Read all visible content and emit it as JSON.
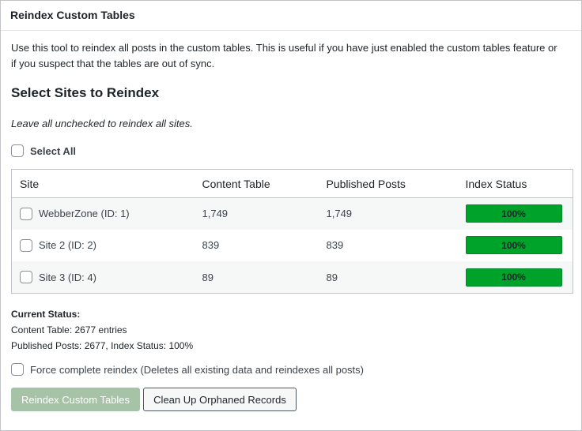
{
  "panel": {
    "title": "Reindex Custom Tables"
  },
  "description": "Use this tool to reindex all posts in the custom tables. This is useful if you have just enabled the custom tables feature or if you suspect that the tables are out of sync.",
  "section": {
    "title": "Select Sites to Reindex",
    "hint": "Leave all unchecked to reindex all sites."
  },
  "select_all": {
    "label": "Select All",
    "checked": false
  },
  "table": {
    "headers": [
      "Site",
      "Content Table",
      "Published Posts",
      "Index Status"
    ],
    "rows": [
      {
        "site": "WebberZone (ID: 1)",
        "content": "1,749",
        "published": "1,749",
        "status": "100%",
        "progress": 100
      },
      {
        "site": "Site 2 (ID: 2)",
        "content": "839",
        "published": "839",
        "status": "100%",
        "progress": 100
      },
      {
        "site": "Site 3 (ID: 4)",
        "content": "89",
        "published": "89",
        "status": "100%",
        "progress": 100
      }
    ]
  },
  "status": {
    "heading": "Current Status:",
    "content_line": "Content Table: 2677 entries",
    "published_line": "Published Posts: 2677, Index Status: 100%"
  },
  "force": {
    "label": "Force complete reindex (Deletes all existing data and reindexes all posts)",
    "checked": false
  },
  "buttons": {
    "reindex": "Reindex Custom Tables",
    "cleanup": "Clean Up Orphaned Records"
  },
  "colors": {
    "progress_green": "#00a32a",
    "primary_disabled": "#a7c3a7"
  }
}
